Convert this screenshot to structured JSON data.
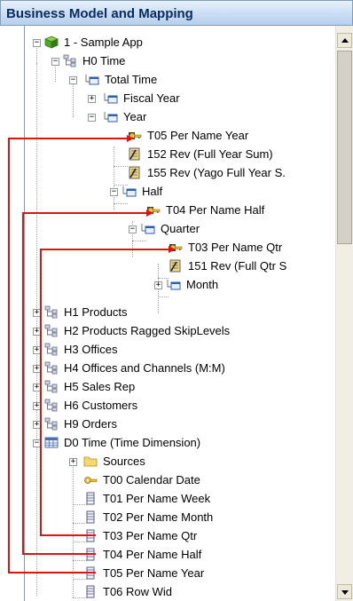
{
  "window": {
    "title": "Business Model and Mapping"
  },
  "colors": {
    "arrow": "#e0140f",
    "title_text": "#0b2b60",
    "table_icon": "#4a6fb5",
    "key_icon": "#c8a020"
  },
  "tree": [
    {
      "label": "1 - Sample App",
      "icon": "database-cube-icon",
      "expander": "-"
    },
    {
      "label": "H0 Time",
      "icon": "hierarchy-icon",
      "expander": "-"
    },
    {
      "label": "Total Time",
      "icon": "level-icon",
      "expander": "-"
    },
    {
      "label": "Fiscal Year",
      "icon": "level-icon",
      "expander": "+"
    },
    {
      "label": "Year",
      "icon": "level-icon",
      "expander": "-"
    },
    {
      "label": "T05 Per Name Year",
      "icon": "key-icon",
      "expander": ""
    },
    {
      "label": "152  Rev  (Full Year Sum)",
      "icon": "measure-icon",
      "expander": ""
    },
    {
      "label": "155  Rev  (Yago Full Year S.",
      "icon": "measure-icon",
      "expander": ""
    },
    {
      "label": "Half",
      "icon": "level-icon",
      "expander": "-"
    },
    {
      "label": "T04 Per Name Half",
      "icon": "key-icon",
      "expander": ""
    },
    {
      "label": "Quarter",
      "icon": "level-icon",
      "expander": "-"
    },
    {
      "label": "T03 Per Name Qtr",
      "icon": "key-icon",
      "expander": ""
    },
    {
      "label": "151  Rev  (Full Qtr S",
      "icon": "measure-icon",
      "expander": ""
    },
    {
      "label": "Month",
      "icon": "level-icon",
      "expander": "+"
    },
    {
      "label": "H1 Products",
      "icon": "hierarchy-icon",
      "expander": "+"
    },
    {
      "label": "H2 Products Ragged SkipLevels",
      "icon": "hierarchy-icon",
      "expander": "+"
    },
    {
      "label": "H3 Offices",
      "icon": "hierarchy-icon",
      "expander": "+"
    },
    {
      "label": "H4 Offices and Channels (M:M)",
      "icon": "hierarchy-icon",
      "expander": "+"
    },
    {
      "label": "H5 Sales Rep",
      "icon": "hierarchy-icon",
      "expander": "+"
    },
    {
      "label": "H6 Customers",
      "icon": "hierarchy-icon",
      "expander": "+"
    },
    {
      "label": "H9 Orders",
      "icon": "hierarchy-icon",
      "expander": "+"
    },
    {
      "label": "D0 Time (Time Dimension)",
      "icon": "table-grid-icon",
      "expander": "-"
    },
    {
      "label": "Sources",
      "icon": "folder-icon",
      "expander": "+"
    },
    {
      "label": "T00 Calendar Date",
      "icon": "key-icon",
      "expander": ""
    },
    {
      "label": "T01 Per Name Week",
      "icon": "column-icon",
      "expander": ""
    },
    {
      "label": "T02 Per Name Month",
      "icon": "column-icon",
      "expander": ""
    },
    {
      "label": "T03 Per Name Qtr",
      "icon": "column-icon",
      "expander": ""
    },
    {
      "label": "T04 Per Name Half",
      "icon": "column-icon",
      "expander": ""
    },
    {
      "label": "T05 Per Name Year",
      "icon": "column-icon",
      "expander": ""
    },
    {
      "label": "T06 Row Wid",
      "icon": "column-icon",
      "expander": ""
    }
  ]
}
